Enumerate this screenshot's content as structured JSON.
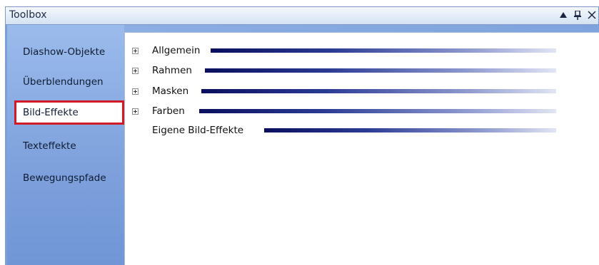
{
  "window": {
    "title": "Toolbox",
    "buttons": {
      "dropdown_icon": "triangle-up-icon",
      "pin_icon": "pin-icon",
      "close_icon": "close-icon"
    }
  },
  "sidebar": {
    "items": [
      {
        "label": "Diashow-Objekte",
        "selected": false
      },
      {
        "label": "Überblendungen",
        "selected": false
      },
      {
        "label": "Bild-Effekte",
        "selected": true
      },
      {
        "label": "Texteffekte",
        "selected": false
      },
      {
        "label": "Bewegungspfade",
        "selected": false
      }
    ]
  },
  "content": {
    "groups": [
      {
        "label": "Allgemein",
        "expandable": true
      },
      {
        "label": "Rahmen",
        "expandable": true
      },
      {
        "label": "Masken",
        "expandable": true
      },
      {
        "label": "Farben",
        "expandable": true
      },
      {
        "label": "Eigene Bild-Effekte",
        "expandable": false
      }
    ]
  },
  "colors": {
    "selection_border": "#d21a26",
    "sidebar": "#8fb0e4",
    "header_bar": "#0a0f5e"
  }
}
